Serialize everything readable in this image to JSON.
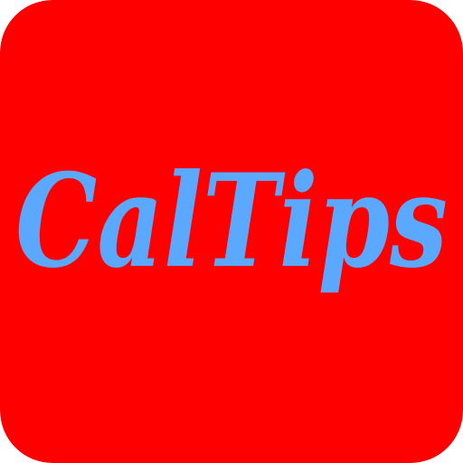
{
  "app_icon": {
    "name": "CalTips",
    "background_color": "#ff0000",
    "text_color": "#5aa8ff",
    "icon_semantic": "caltips-logo-icon"
  }
}
